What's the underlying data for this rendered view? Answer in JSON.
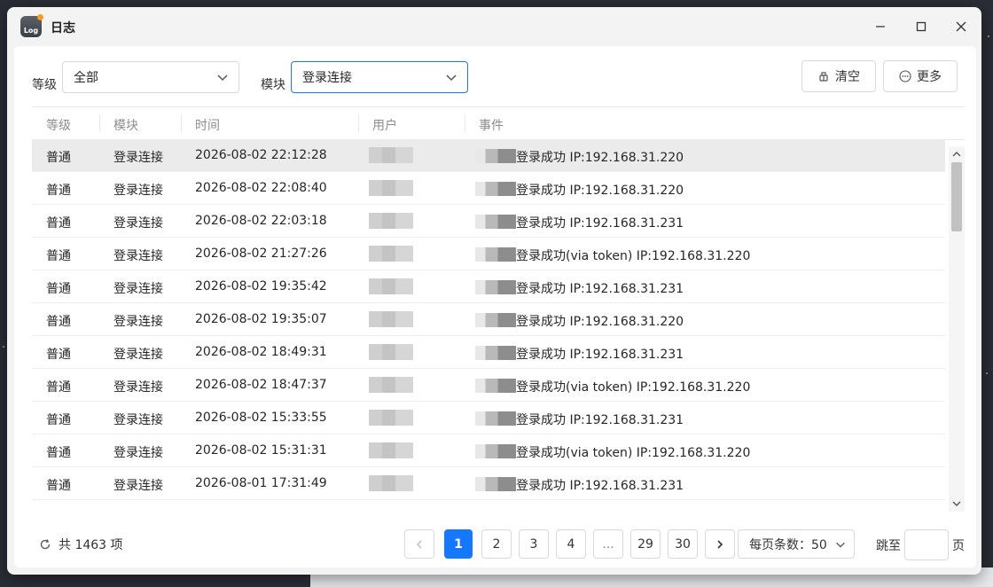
{
  "window": {
    "title": "日志",
    "app_icon_text": "Log"
  },
  "filters": {
    "level_label": "等级",
    "level_value": "全部",
    "module_label": "模块",
    "module_value": "登录连接"
  },
  "actions": {
    "clear_label": "清空",
    "more_label": "更多"
  },
  "table": {
    "headers": [
      "等级",
      "模块",
      "时间",
      "用户",
      "事件"
    ],
    "rows": [
      {
        "level": "普通",
        "module": "登录连接",
        "time": "2026-08-02 22:12:28",
        "event": "登录成功 IP:192.168.31.220"
      },
      {
        "level": "普通",
        "module": "登录连接",
        "time": "2026-08-02 22:08:40",
        "event": "登录成功 IP:192.168.31.220"
      },
      {
        "level": "普通",
        "module": "登录连接",
        "time": "2026-08-02 22:03:18",
        "event": "登录成功 IP:192.168.31.231"
      },
      {
        "level": "普通",
        "module": "登录连接",
        "time": "2026-08-02 21:27:26",
        "event": "登录成功(via token) IP:192.168.31.220"
      },
      {
        "level": "普通",
        "module": "登录连接",
        "time": "2026-08-02 19:35:42",
        "event": "登录成功 IP:192.168.31.231"
      },
      {
        "level": "普通",
        "module": "登录连接",
        "time": "2026-08-02 19:35:07",
        "event": "登录成功 IP:192.168.31.220"
      },
      {
        "level": "普通",
        "module": "登录连接",
        "time": "2026-08-02 18:49:31",
        "event": "登录成功 IP:192.168.31.231"
      },
      {
        "level": "普通",
        "module": "登录连接",
        "time": "2026-08-02 18:47:37",
        "event": "登录成功(via token) IP:192.168.31.220"
      },
      {
        "level": "普通",
        "module": "登录连接",
        "time": "2026-08-02 15:33:55",
        "event": "登录成功 IP:192.168.31.231"
      },
      {
        "level": "普通",
        "module": "登录连接",
        "time": "2026-08-02 15:31:31",
        "event": "登录成功(via token) IP:192.168.31.220"
      },
      {
        "level": "普通",
        "module": "登录连接",
        "time": "2026-08-01 17:31:49",
        "event": "登录成功 IP:192.168.31.231"
      }
    ]
  },
  "footer": {
    "total_text": "共 1463 项",
    "pages": [
      "1",
      "2",
      "3",
      "4",
      "...",
      "29",
      "30"
    ],
    "current_page": "1",
    "page_size_text": "每页条数：50",
    "jump_prefix": "跳至",
    "jump_suffix": "页"
  },
  "colors": {
    "accent": "#1677ff",
    "selected_row": "#ebebeb"
  }
}
